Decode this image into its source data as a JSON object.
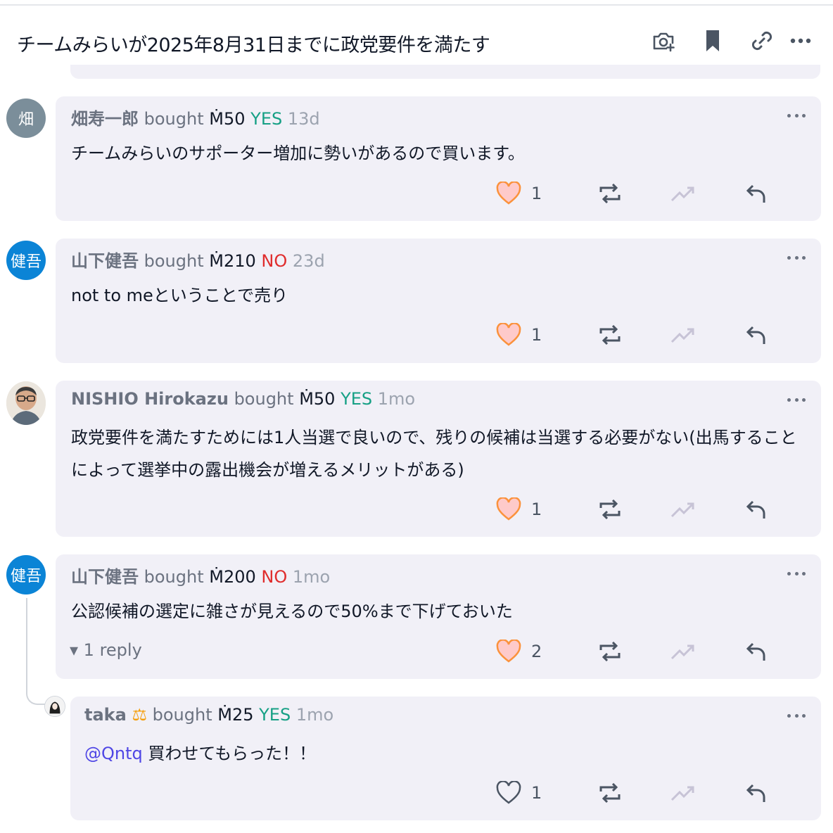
{
  "header": {
    "title": "チームみらいが2025年8月31日までに政党要件を満たす",
    "icons": [
      "camera-plus-icon",
      "bookmark-icon",
      "link-icon",
      "more-icon"
    ]
  },
  "verbs": {
    "bought": "bought"
  },
  "comments": [
    {
      "avatar_text": "畑",
      "avatar_color": "#7b8e9a",
      "user": "畑寿一郎",
      "amount": "Ṁ50",
      "outcome": "YES",
      "time": "13d",
      "text": "チームみらいのサポーター増加に勢いがあるので買います。",
      "likes": "1"
    },
    {
      "avatar_text": "健吾",
      "avatar_color": "#0b84d6",
      "user": "山下健吾",
      "amount": "Ṁ210",
      "outcome": "NO",
      "time": "23d",
      "text": "not to meということで売り",
      "likes": "1"
    },
    {
      "avatar_text": "",
      "avatar_color": "#d9d2c8",
      "user": "NISHIO Hirokazu",
      "amount": "Ṁ50",
      "outcome": "YES",
      "time": "1mo",
      "text": "政党要件を満たすためには1人当選で良いので、残りの候補は当選する必要がない(出馬することによって選挙中の露出機会が増えるメリットがある)",
      "likes": "1"
    },
    {
      "avatar_text": "健吾",
      "avatar_color": "#0b84d6",
      "user": "山下健吾",
      "amount": "Ṁ200",
      "outcome": "NO",
      "time": "1mo",
      "text": "公認候補の選定に雑さが見えるので50%まで下げておいた",
      "likes": "2",
      "replies_label": "▾ 1 reply"
    },
    {
      "avatar_text": "",
      "avatar_color": "#ffffff",
      "user": "taka",
      "badge": "⚖",
      "amount": "Ṁ25",
      "outcome": "YES",
      "time": "1mo",
      "mention": "@Qntq",
      "text": " 買わせてもらった！！",
      "likes": "1"
    }
  ],
  "colors": {
    "yes": "#16a085",
    "no": "#e02d2d",
    "card_bg": "#f1f0f7",
    "mention": "#4f46e5"
  }
}
